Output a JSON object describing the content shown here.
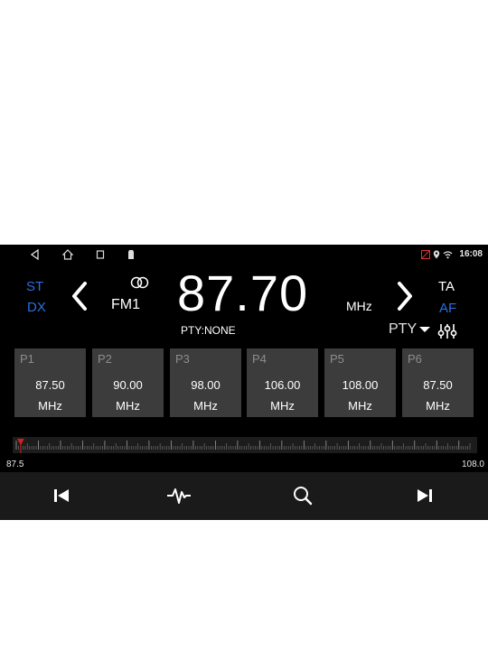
{
  "status_bar": {
    "nav_icons": [
      "back-icon",
      "home-icon",
      "recents-icon",
      "sd-card-icon"
    ],
    "status_icons": [
      "signal-icon",
      "location-icon",
      "wifi-icon"
    ],
    "time": "16:08"
  },
  "radio": {
    "st_label": "ST",
    "dx_label": "DX",
    "band": "FM1",
    "frequency": "87.70",
    "unit": "MHz",
    "pty_status": "PTY:NONE",
    "ta_label": "TA",
    "af_label": "AF",
    "pty_select": "PTY"
  },
  "presets": [
    {
      "label": "P1",
      "freq": "87.50",
      "unit": "MHz"
    },
    {
      "label": "P2",
      "freq": "90.00",
      "unit": "MHz"
    },
    {
      "label": "P3",
      "freq": "98.00",
      "unit": "MHz"
    },
    {
      "label": "P4",
      "freq": "106.00",
      "unit": "MHz"
    },
    {
      "label": "P5",
      "freq": "108.00",
      "unit": "MHz"
    },
    {
      "label": "P6",
      "freq": "87.50",
      "unit": "MHz"
    }
  ],
  "scale": {
    "min_label": "87.5",
    "max_label": "108.0",
    "min": 87.5,
    "max": 108.0,
    "current": 87.7
  },
  "controls": [
    "previous-icon",
    "seek-waveform-icon",
    "search-icon",
    "next-icon"
  ],
  "colors": {
    "accent_blue": "#2b6fe0",
    "marker_red": "#d02020",
    "preset_bg": "#3c3c3c",
    "background": "#000000"
  }
}
